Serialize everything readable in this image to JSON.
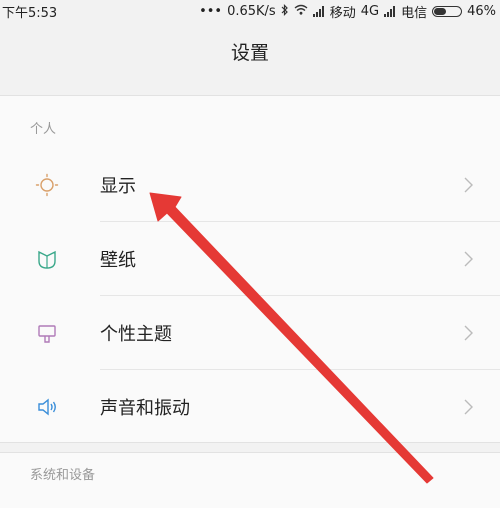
{
  "status_bar": {
    "time": "下午5:53",
    "dots": "•••",
    "speed": "0.65K/s",
    "carrier1": "移动",
    "network": "4G",
    "carrier2": "电信",
    "battery": "46%",
    "battery_level": 0.46
  },
  "header": {
    "title": "设置"
  },
  "sections": [
    {
      "label": "个人",
      "items": [
        {
          "label": "显示",
          "icon": "brightness-icon",
          "color": "#d9a06a"
        },
        {
          "label": "壁纸",
          "icon": "wallpaper-icon",
          "color": "#3aa88a"
        },
        {
          "label": "个性主题",
          "icon": "theme-icon",
          "color": "#b07ab8"
        },
        {
          "label": "声音和振动",
          "icon": "sound-icon",
          "color": "#3a8ed9"
        }
      ]
    },
    {
      "label": "系统和设备",
      "items": []
    }
  ],
  "annotation": {
    "arrow_color": "#e53935"
  }
}
